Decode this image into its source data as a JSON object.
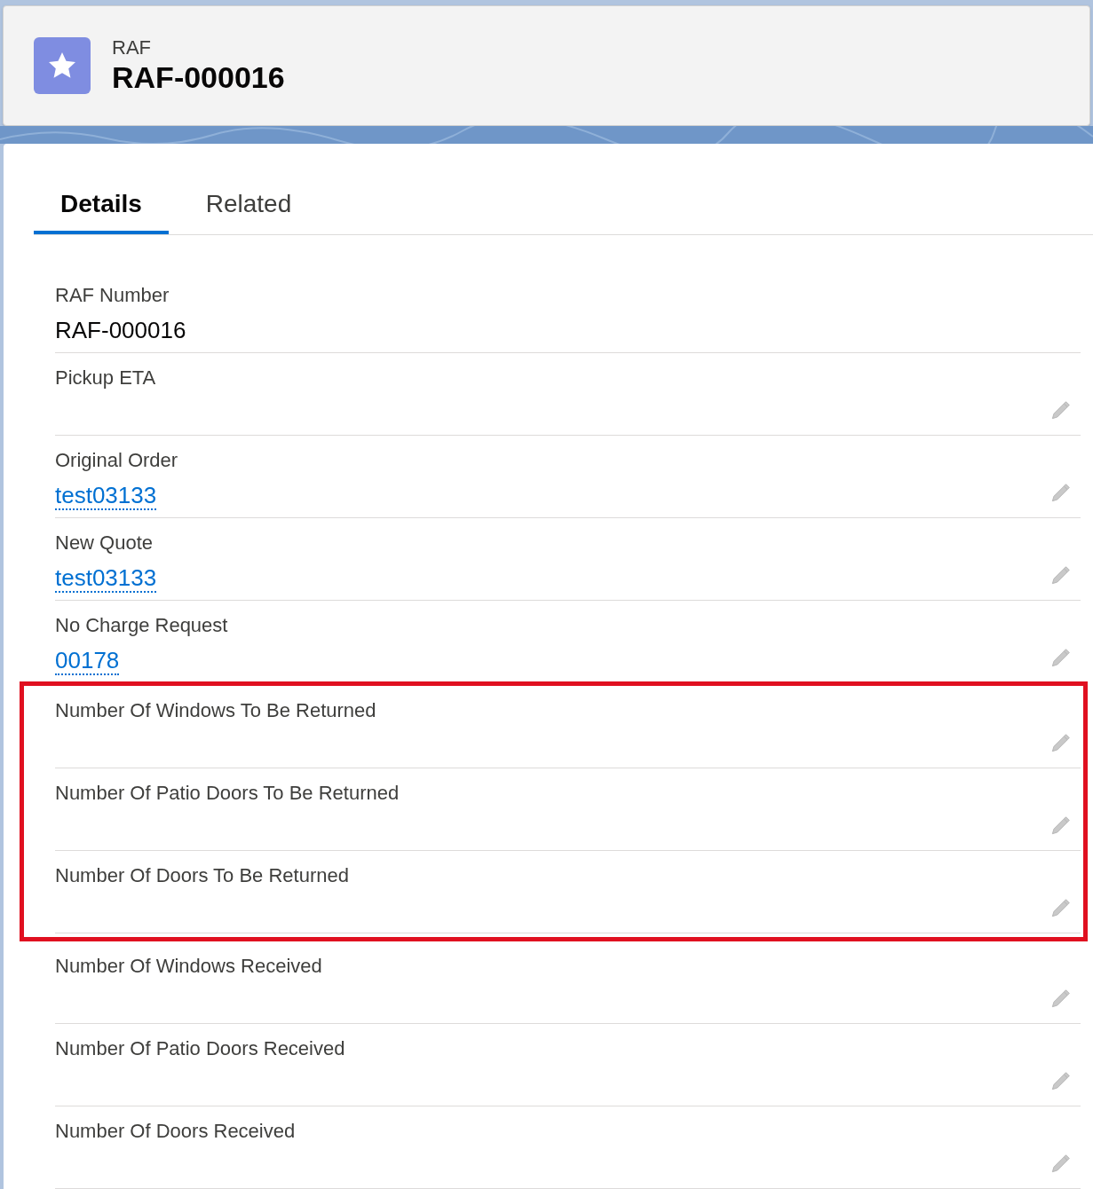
{
  "header": {
    "object_label": "RAF",
    "record_title": "RAF-000016"
  },
  "tabs": [
    {
      "label": "Details",
      "selected": true
    },
    {
      "label": "Related",
      "selected": false
    }
  ],
  "fields": [
    {
      "label": "RAF Number",
      "value": "RAF-000016",
      "kind": "text",
      "editable": false,
      "highlighted": false
    },
    {
      "label": "Pickup ETA",
      "kind": "text",
      "editable": true,
      "highlighted": false
    },
    {
      "label": "Original Order",
      "value": "test03133",
      "kind": "link",
      "editable": true,
      "highlighted": false
    },
    {
      "label": "New Quote",
      "value": "test03133",
      "kind": "link",
      "editable": true,
      "highlighted": false
    },
    {
      "label": "No Charge Request",
      "value": "00178",
      "kind": "link",
      "editable": true,
      "highlighted": false
    },
    {
      "label": "Number Of Windows To Be Returned",
      "kind": "text",
      "editable": true,
      "highlighted": true
    },
    {
      "label": "Number Of Patio Doors To Be Returned",
      "kind": "text",
      "editable": true,
      "highlighted": true
    },
    {
      "label": "Number Of Doors To Be Returned",
      "kind": "text",
      "editable": true,
      "highlighted": true
    },
    {
      "label": "Number Of Windows Received",
      "kind": "text",
      "editable": true,
      "highlighted": false
    },
    {
      "label": "Number Of Patio Doors Received",
      "kind": "text",
      "editable": true,
      "highlighted": false
    },
    {
      "label": "Number Of Doors Received",
      "kind": "text",
      "editable": true,
      "highlighted": false
    }
  ]
}
